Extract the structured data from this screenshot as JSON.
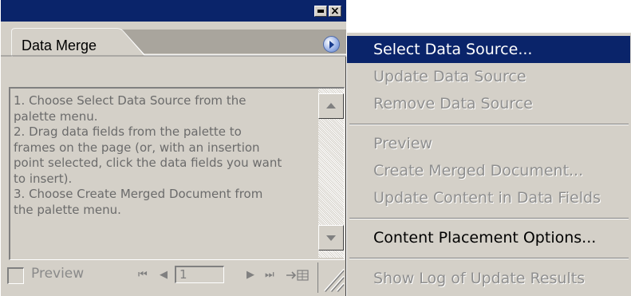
{
  "palette": {
    "tab_label": "Data Merge",
    "instructions": "1. Choose Select Data Source from the\npalette menu.\n2. Drag data fields from the palette to\nframes on the page (or, with an insertion\npoint selected, click the data fields you want\nto insert).\n3. Choose Create Merged Document from\nthe palette menu.",
    "preview_label": "Preview",
    "record_value": "1",
    "icons": {
      "minimize": "minimize-icon",
      "close": "close-icon",
      "palette_menu": "palette-menu-icon",
      "first": "first-record-icon",
      "prev": "previous-record-icon",
      "next": "next-record-icon",
      "last": "last-record-icon",
      "goto": "go-to-record-icon",
      "resize": "resize-grip-icon"
    }
  },
  "menu": {
    "items": [
      {
        "label": "Select Data Source...",
        "state": "selected"
      },
      {
        "label": "Update Data Source",
        "state": "disabled"
      },
      {
        "label": "Remove Data Source",
        "state": "disabled"
      },
      {
        "label": "Preview",
        "state": "disabled"
      },
      {
        "label": "Create Merged Document...",
        "state": "disabled"
      },
      {
        "label": "Update Content in Data Fields",
        "state": "disabled"
      },
      {
        "label": "Content Placement Options...",
        "state": "enabled"
      },
      {
        "label": "Show Log of Update Results",
        "state": "disabled"
      }
    ]
  },
  "colors": {
    "titlebar": "#0a246a",
    "face": "#d4d0c8",
    "highlight": "#0a246a",
    "disabled_text": "#8f8f8f"
  }
}
